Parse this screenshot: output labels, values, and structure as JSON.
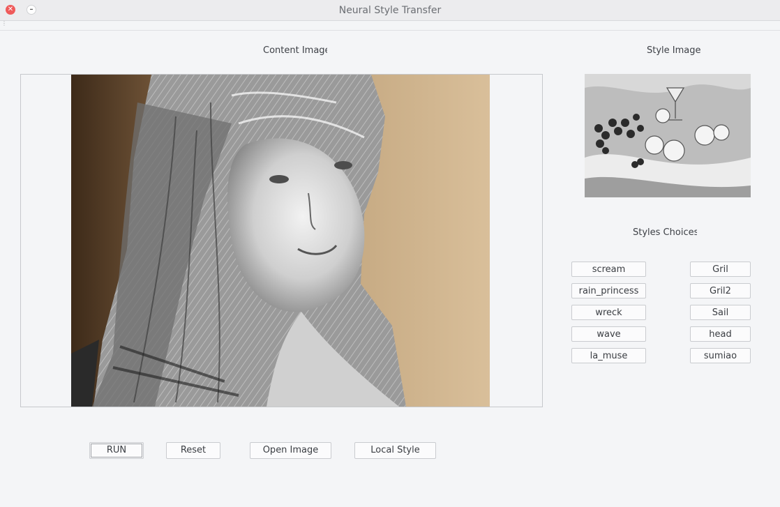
{
  "window": {
    "title": "Neural Style Transfer"
  },
  "content": {
    "label": "Content Image"
  },
  "style": {
    "label": "Style Image"
  },
  "choices": {
    "label": "Styles Choices",
    "left": [
      "scream",
      "rain_princess",
      "wreck",
      "wave",
      "la_muse"
    ],
    "right": [
      "Gril",
      "Gril2",
      "Sail",
      "head",
      "sumiao"
    ]
  },
  "actions": {
    "run": "RUN",
    "reset": "Reset",
    "open": "Open Image",
    "local": "Local Style"
  }
}
